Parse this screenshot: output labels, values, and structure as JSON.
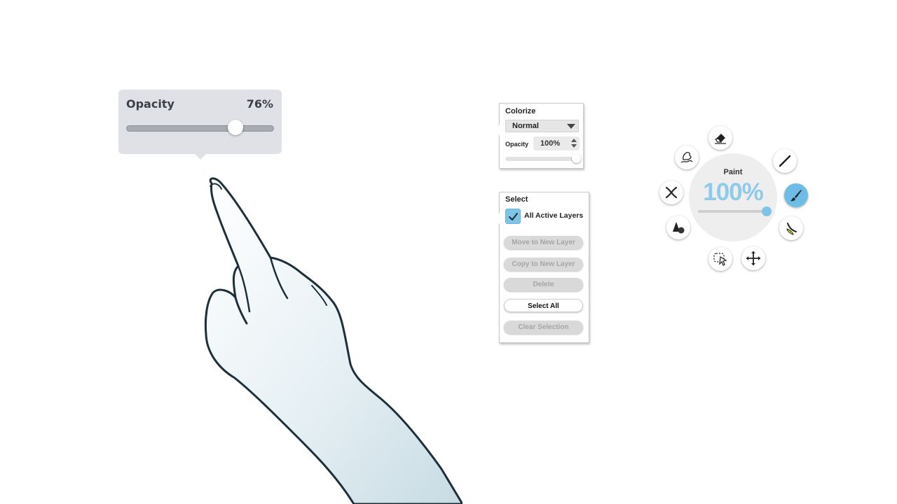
{
  "opacity_tooltip": {
    "label": "Opacity",
    "value_text": "76%",
    "value": 0.76
  },
  "colorize_panel": {
    "title": "Colorize",
    "blend_mode": "Normal",
    "opacity_label": "Opacity",
    "opacity_value": "100%",
    "opacity_level": 1.0
  },
  "select_panel": {
    "title": "Select",
    "all_active_layers_label": "All Active Layers",
    "all_active_layers_checked": true,
    "buttons": [
      {
        "label": "Move to New Layer",
        "enabled": false
      },
      {
        "label": "Copy to New Layer",
        "enabled": false
      },
      {
        "label": "Delete",
        "enabled": false
      },
      {
        "label": "Select All",
        "enabled": true
      },
      {
        "label": "Clear Selection",
        "enabled": false
      }
    ]
  },
  "tool_wheel": {
    "mode_label": "Paint",
    "value_text": "100%",
    "value": 1.0,
    "accent_color": "#6fbde4",
    "tools": [
      {
        "icon": "eraser-icon"
      },
      {
        "icon": "line-icon"
      },
      {
        "icon": "brush-icon",
        "active": true
      },
      {
        "icon": "fill-icon"
      },
      {
        "icon": "move-icon"
      },
      {
        "icon": "selection-icon"
      },
      {
        "icon": "shapes-icon"
      },
      {
        "icon": "symmetry-icon"
      },
      {
        "icon": "smudge-icon"
      }
    ]
  }
}
